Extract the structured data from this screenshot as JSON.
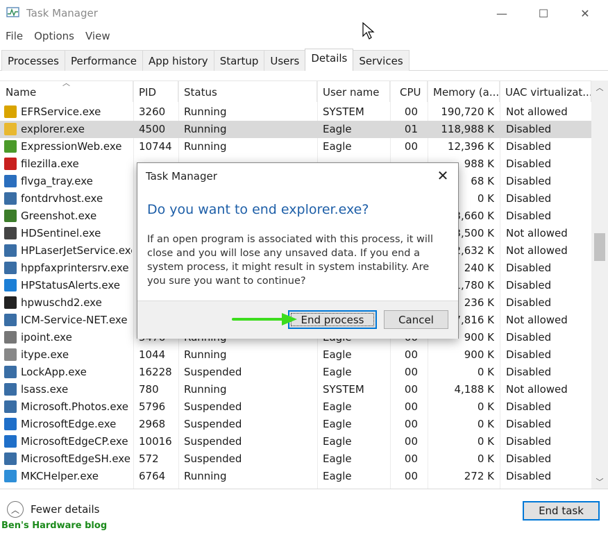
{
  "window": {
    "title": "Task Manager",
    "controls": {
      "minimize": "—",
      "maximize": "☐",
      "close": "✕"
    }
  },
  "menu": [
    "File",
    "Options",
    "View"
  ],
  "tabs": [
    {
      "label": "Processes",
      "active": false
    },
    {
      "label": "Performance",
      "active": false
    },
    {
      "label": "App history",
      "active": false
    },
    {
      "label": "Startup",
      "active": false
    },
    {
      "label": "Users",
      "active": false
    },
    {
      "label": "Details",
      "active": true
    },
    {
      "label": "Services",
      "active": false
    }
  ],
  "table": {
    "columns": [
      "Name",
      "PID",
      "Status",
      "User name",
      "CPU",
      "Memory (a...",
      "UAC virtualizat..."
    ],
    "rows": [
      {
        "name": "EFRService.exe",
        "pid": "3260",
        "status": "Running",
        "user": "SYSTEM",
        "cpu": "00",
        "memory": "190,720 K",
        "uac": "Not allowed",
        "icon": "lock-icon",
        "color": "#d9a400",
        "selected": false
      },
      {
        "name": "explorer.exe",
        "pid": "4500",
        "status": "Running",
        "user": "Eagle",
        "cpu": "01",
        "memory": "118,988 K",
        "uac": "Disabled",
        "icon": "folder-icon",
        "color": "#e8b830",
        "selected": true
      },
      {
        "name": "ExpressionWeb.exe",
        "pid": "10744",
        "status": "Running",
        "user": "Eagle",
        "cpu": "00",
        "memory": "12,396 K",
        "uac": "Disabled",
        "icon": "expression-web-icon",
        "color": "#4b9a2a",
        "selected": false
      },
      {
        "name": "filezilla.exe",
        "pid": "",
        "status": "",
        "user": "",
        "cpu": "",
        "memory": "988 K",
        "uac": "Disabled",
        "icon": "filezilla-icon",
        "color": "#c8201e",
        "selected": false
      },
      {
        "name": "flvga_tray.exe",
        "pid": "",
        "status": "",
        "user": "",
        "cpu": "",
        "memory": "68 K",
        "uac": "Disabled",
        "icon": "flvga-icon",
        "color": "#2a6ebe",
        "selected": false
      },
      {
        "name": "fontdrvhost.exe",
        "pid": "",
        "status": "",
        "user": "",
        "cpu": "",
        "memory": "0 K",
        "uac": "Disabled",
        "icon": "service-window-icon",
        "color": "#3a6ea5",
        "selected": false
      },
      {
        "name": "Greenshot.exe",
        "pid": "",
        "status": "",
        "user": "",
        "cpu": "",
        "memory": "3,660 K",
        "uac": "Disabled",
        "icon": "greenshot-icon",
        "color": "#3c7d2a",
        "selected": false
      },
      {
        "name": "HDSentinel.exe",
        "pid": "",
        "status": "",
        "user": "",
        "cpu": "",
        "memory": "3,500 K",
        "uac": "Not allowed",
        "icon": "hdsentinel-icon",
        "color": "#444444",
        "selected": false
      },
      {
        "name": "HPLaserJetService.exe",
        "pid": "",
        "status": "",
        "user": "",
        "cpu": "",
        "memory": "2,632 K",
        "uac": "Not allowed",
        "icon": "service-window-icon",
        "color": "#3a6ea5",
        "selected": false
      },
      {
        "name": "hppfaxprintersrv.exe",
        "pid": "",
        "status": "",
        "user": "",
        "cpu": "",
        "memory": "240 K",
        "uac": "Disabled",
        "icon": "service-window-icon",
        "color": "#3a6ea5",
        "selected": false
      },
      {
        "name": "HPStatusAlerts.exe",
        "pid": "",
        "status": "",
        "user": "",
        "cpu": "",
        "memory": "1,780 K",
        "uac": "Disabled",
        "icon": "hp-status-icon",
        "color": "#1c7fd6",
        "selected": false
      },
      {
        "name": "hpwuschd2.exe",
        "pid": "",
        "status": "",
        "user": "",
        "cpu": "",
        "memory": "236 K",
        "uac": "Disabled",
        "icon": "barcode-icon",
        "color": "#222222",
        "selected": false
      },
      {
        "name": "ICM-Service-NET.exe",
        "pid": "",
        "status": "",
        "user": "",
        "cpu": "",
        "memory": "7,816 K",
        "uac": "Not allowed",
        "icon": "service-window-icon",
        "color": "#3a6ea5",
        "selected": false
      },
      {
        "name": "ipoint.exe",
        "pid": "",
        "status": "",
        "user": "",
        "cpu": "",
        "memory": "900 K",
        "uac": "Disabled",
        "icon": "pointer-icon",
        "color": "#777777",
        "selected": false
      },
      {
        "name": "itype.exe",
        "pid": "1044",
        "status": "Running",
        "user": "Eagle",
        "cpu": "00",
        "memory": "900 K",
        "uac": "Disabled",
        "icon": "keyboard-icon",
        "color": "#888888",
        "selected": false
      },
      {
        "name": "LockApp.exe",
        "pid": "16228",
        "status": "Suspended",
        "user": "Eagle",
        "cpu": "00",
        "memory": "0 K",
        "uac": "Disabled",
        "icon": "service-window-icon",
        "color": "#3a6ea5",
        "selected": false
      },
      {
        "name": "lsass.exe",
        "pid": "780",
        "status": "Running",
        "user": "SYSTEM",
        "cpu": "00",
        "memory": "4,188 K",
        "uac": "Not allowed",
        "icon": "service-window-icon",
        "color": "#3a6ea5",
        "selected": false
      },
      {
        "name": "Microsoft.Photos.exe",
        "pid": "5796",
        "status": "Suspended",
        "user": "Eagle",
        "cpu": "00",
        "memory": "0 K",
        "uac": "Disabled",
        "icon": "service-window-icon",
        "color": "#3a6ea5",
        "selected": false
      },
      {
        "name": "MicrosoftEdge.exe",
        "pid": "2968",
        "status": "Suspended",
        "user": "Eagle",
        "cpu": "00",
        "memory": "0 K",
        "uac": "Disabled",
        "icon": "edge-icon",
        "color": "#1f6fc9",
        "selected": false
      },
      {
        "name": "MicrosoftEdgeCP.exe",
        "pid": "10016",
        "status": "Suspended",
        "user": "Eagle",
        "cpu": "00",
        "memory": "0 K",
        "uac": "Disabled",
        "icon": "edge-icon",
        "color": "#1f6fc9",
        "selected": false
      },
      {
        "name": "MicrosoftEdgeSH.exe",
        "pid": "572",
        "status": "Suspended",
        "user": "Eagle",
        "cpu": "00",
        "memory": "0 K",
        "uac": "Disabled",
        "icon": "service-window-icon",
        "color": "#3a6ea5",
        "selected": false
      },
      {
        "name": "MKCHelper.exe",
        "pid": "6764",
        "status": "Running",
        "user": "Eagle",
        "cpu": "00",
        "memory": "272 K",
        "uac": "Disabled",
        "icon": "mkc-helper-icon",
        "color": "#2f8fd8",
        "selected": false
      }
    ],
    "partial_row_visible": {
      "pid": "5476",
      "status": "Running",
      "user": "Eagle",
      "cpu": "00"
    }
  },
  "footer": {
    "fewer_details": "Fewer details",
    "end_task": "End task",
    "watermark": "Ben's Hardware blog"
  },
  "dialog": {
    "title": "Task Manager",
    "heading": "Do you want to end explorer.exe?",
    "body": "If an open program is associated with this process, it will close and you will lose any unsaved data. If you end a system process, it might result in system instability. Are you sure you want to continue?",
    "primary_button": "End process",
    "cancel_button": "Cancel",
    "close": "✕"
  },
  "colors": {
    "accent": "#0078d7",
    "heading_blue": "#1e5fa8",
    "selected_row": "#d9d9d9",
    "annotation_arrow": "#3ddc1e",
    "watermark": "#1a8a1a"
  }
}
